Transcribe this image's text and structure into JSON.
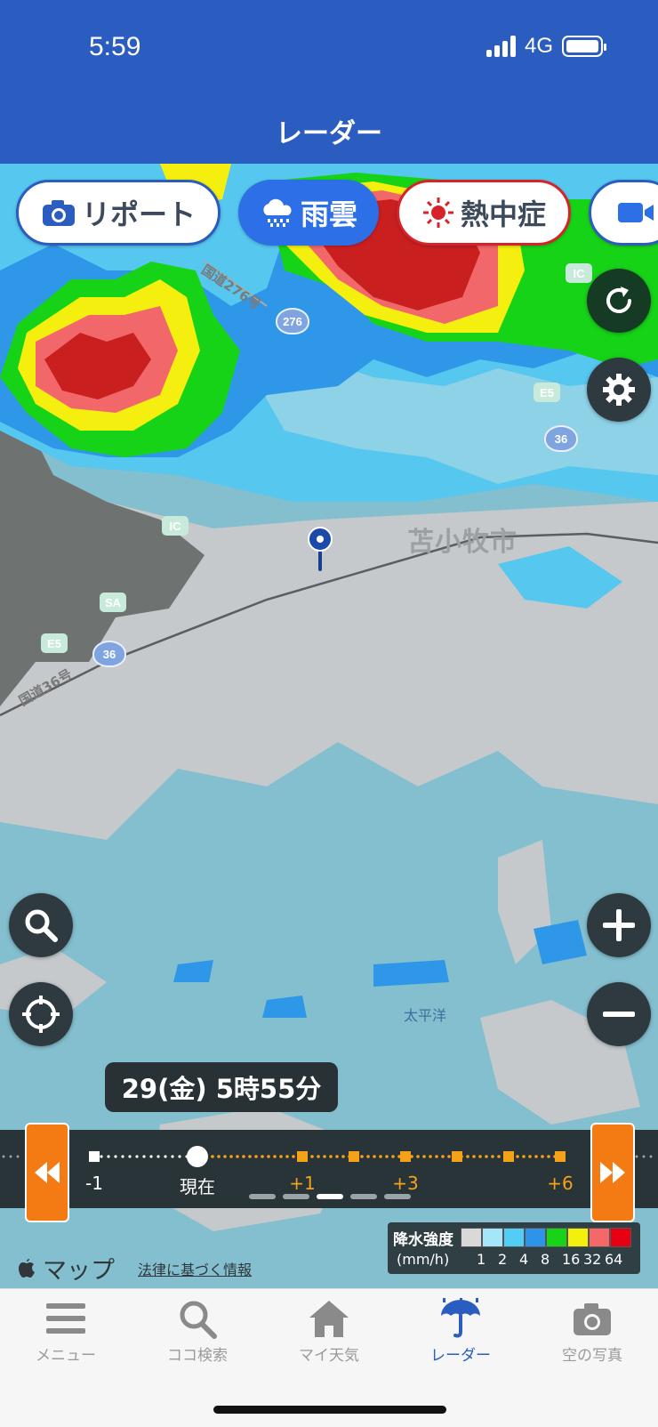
{
  "status": {
    "time": "5:59",
    "network": "4G"
  },
  "header": {
    "title": "レーダー"
  },
  "chips": [
    {
      "label": "リポート",
      "icon": "camera-icon"
    },
    {
      "label": "雨雲",
      "icon": "rain-cloud-icon",
      "active": true
    },
    {
      "label": "熱中症",
      "icon": "sun-icon"
    },
    {
      "label": "",
      "icon": "video-icon"
    }
  ],
  "map": {
    "city": "苫小牧市",
    "sea": "太平洋",
    "roads": [
      "国道276号",
      "国道36号"
    ],
    "badges": [
      "IC",
      "E5",
      "36",
      "276",
      "SA"
    ]
  },
  "timebar": {
    "current": "29(金) 5時55分",
    "labels": [
      "-1",
      "現在",
      "+1",
      "+3",
      "+6"
    ],
    "colors": {
      "past": "#ffffff",
      "future": "#f5a21a",
      "button": "#f47a14"
    }
  },
  "footer": {
    "maps": "マップ",
    "legal": "法律に基づく情報"
  },
  "legend": {
    "title": "降水強度",
    "unit": "(mm/h)",
    "values": [
      "1",
      "2",
      "4",
      "8",
      "16",
      "32",
      "64"
    ],
    "colors": [
      "#d9d9d9",
      "#a6e6fb",
      "#52cdf5",
      "#2e94ea",
      "#19d319",
      "#f4f00e",
      "#f5686a",
      "#e60012"
    ]
  },
  "tabs": [
    {
      "label": "メニュー",
      "icon": "menu-icon"
    },
    {
      "label": "ココ検索",
      "icon": "search-icon"
    },
    {
      "label": "マイ天気",
      "icon": "home-icon"
    },
    {
      "label": "レーダー",
      "icon": "umbrella-icon",
      "active": true
    },
    {
      "label": "空の写真",
      "icon": "camera-icon"
    }
  ],
  "colors": {
    "brand": "#2b5cbf",
    "accent": "#f47a14"
  }
}
